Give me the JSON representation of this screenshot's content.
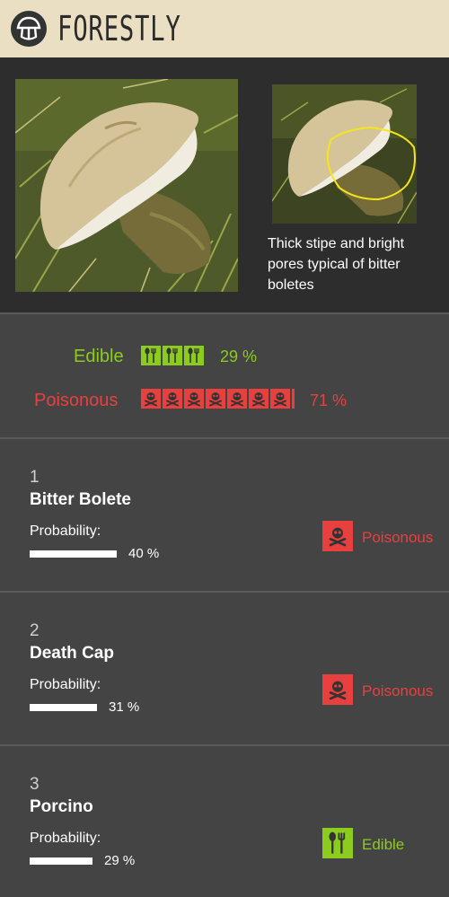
{
  "app": {
    "brand": "FORESTLY",
    "logo_icon": "mushroom-logo-icon"
  },
  "photos": {
    "main_alt": "Photo of the mushroom being identified",
    "detail_alt": "Close-up of the stipe with highlighted region",
    "caption": "Thick stipe and bright pores typical of bitter boletes"
  },
  "summary": {
    "edible": {
      "label": "Edible",
      "percent": "29 %",
      "value": 0.29,
      "icon": "fork-spoon-icon",
      "color": "#8ccc1e"
    },
    "poisonous": {
      "label": "Poisonous",
      "percent": "71 %",
      "value": 0.71,
      "icon": "skull-crossbones-icon",
      "color": "#e8403f"
    }
  },
  "results": [
    {
      "rank": "1",
      "name": "Bitter Bolete",
      "probability_label": "Probability:",
      "probability_text": "40 %",
      "probability": 0.4,
      "verdict": "Poisonous",
      "verdict_icon": "skull-crossbones-icon"
    },
    {
      "rank": "2",
      "name": "Death Cap",
      "probability_label": "Probability:",
      "probability_text": "31 %",
      "probability": 0.31,
      "verdict": "Poisonous",
      "verdict_icon": "skull-crossbones-icon"
    },
    {
      "rank": "3",
      "name": "Porcino",
      "probability_label": "Probability:",
      "probability_text": "29 %",
      "probability": 0.29,
      "verdict": "Edible",
      "verdict_icon": "fork-spoon-icon"
    }
  ],
  "colors": {
    "header_bg": "#ebdfc3",
    "edible": "#8ccc1e",
    "poisonous": "#e8403f",
    "card_bg": "#444444"
  }
}
